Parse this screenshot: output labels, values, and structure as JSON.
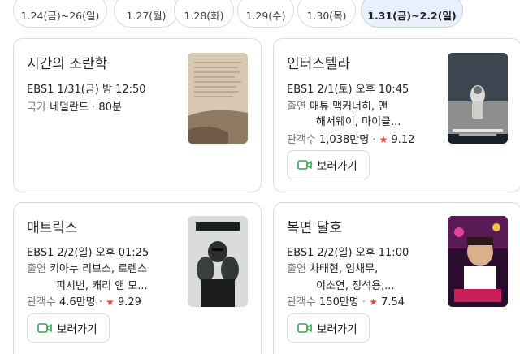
{
  "date_chips": [
    {
      "label": "1.24(금)~26(일)"
    },
    {
      "label": "1.27(월)"
    },
    {
      "label": "1.28(화)"
    },
    {
      "label": "1.29(수)"
    },
    {
      "label": "1.30(목)"
    },
    {
      "label": "1.31(금)~2.2(일)",
      "selected": true
    }
  ],
  "cards": [
    {
      "title": "시간의 조란학",
      "schedule": "EBS1 1/31(금) 밤 12:50",
      "country_label": "국가",
      "country": "네덜란드",
      "duration": "80분"
    },
    {
      "title": "인터스텔라",
      "schedule": "EBS1 2/1(토) 오후 10:45",
      "cast_label": "출연",
      "cast_line1": "매튜 맥커너히, 앤",
      "cast_line2": "해서웨이, 마이클...",
      "audience_label": "관객수",
      "audience": "1,038만명",
      "rating": "9.12",
      "watch_label": "보러가기"
    },
    {
      "title": "매트릭스",
      "schedule": "EBS1 2/2(일) 오후 01:25",
      "cast_label": "출연",
      "cast_line1": "키아누 리브스, 로렌스",
      "cast_line2": "피시번, 캐리 앤 모...",
      "audience_label": "관객수",
      "audience": "4.6만명",
      "rating": "9.29",
      "watch_label": "보러가기"
    },
    {
      "title": "복면 달호",
      "schedule": "EBS1 2/2(일) 오후 11:00",
      "cast_label": "출연",
      "cast_line1": "차태현, 임채무,",
      "cast_line2": "이소연, 정석용,...",
      "audience_label": "관객수",
      "audience": "150만명",
      "rating": "7.54",
      "watch_label": "보러가기"
    }
  ],
  "icons": {
    "star": "star-icon",
    "watch": "video-camera-icon"
  },
  "colors": {
    "selected_chip_bg": "#e8f0fe",
    "star": "#e8453c",
    "watch_icon": "#34a853"
  }
}
